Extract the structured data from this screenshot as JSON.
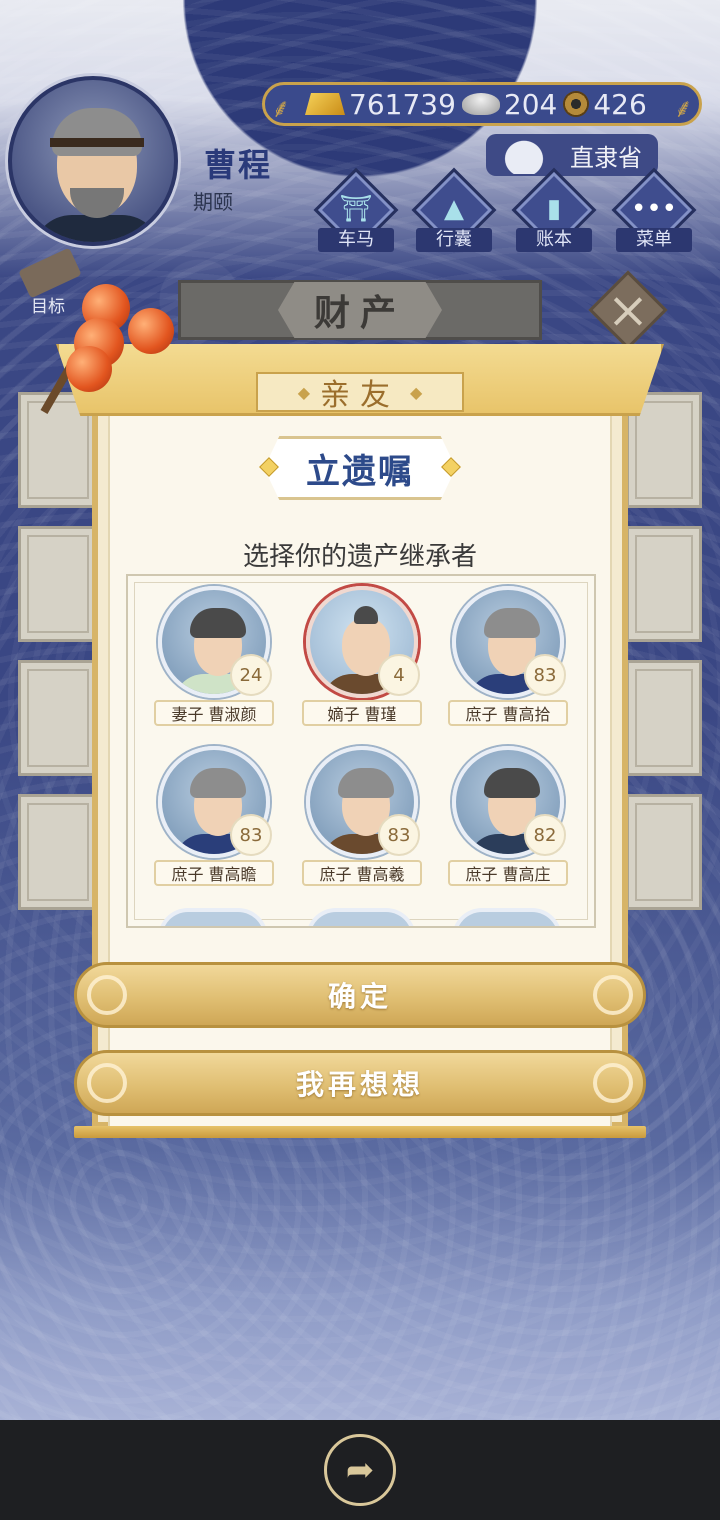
{
  "player": {
    "name": "曹程",
    "title": "期颐"
  },
  "currency": {
    "gold": "761739",
    "silver": "204",
    "coins": "426"
  },
  "location": "直隶省",
  "menu": [
    {
      "label": "车马",
      "icon": "carriage-icon"
    },
    {
      "label": "行囊",
      "icon": "bag-icon"
    },
    {
      "label": "账本",
      "icon": "ledger-icon"
    },
    {
      "label": "菜单",
      "icon": "more-icon"
    }
  ],
  "goal_label": "目标",
  "property_tab": "财产",
  "dialog": {
    "header": "亲友",
    "title": "立遗嘱",
    "subtitle": "选择你的遗产继承者",
    "heirs": [
      {
        "relation": "妻子 曹淑颜",
        "age": "24"
      },
      {
        "relation": "嫡子 曹瑾",
        "age": "4"
      },
      {
        "relation": "庶子 曹高拾",
        "age": "83"
      },
      {
        "relation": "庶子 曹高瞻",
        "age": "83"
      },
      {
        "relation": "庶子 曹高羲",
        "age": "83"
      },
      {
        "relation": "庶子 曹高庄",
        "age": "82"
      }
    ],
    "confirm_label": "确定",
    "reconsider_label": "我再想想"
  },
  "colors": {
    "navy": "#3a4784",
    "gold": "#c9a24c",
    "paper": "#fbf7ec",
    "title_blue": "#2d4a8a"
  }
}
